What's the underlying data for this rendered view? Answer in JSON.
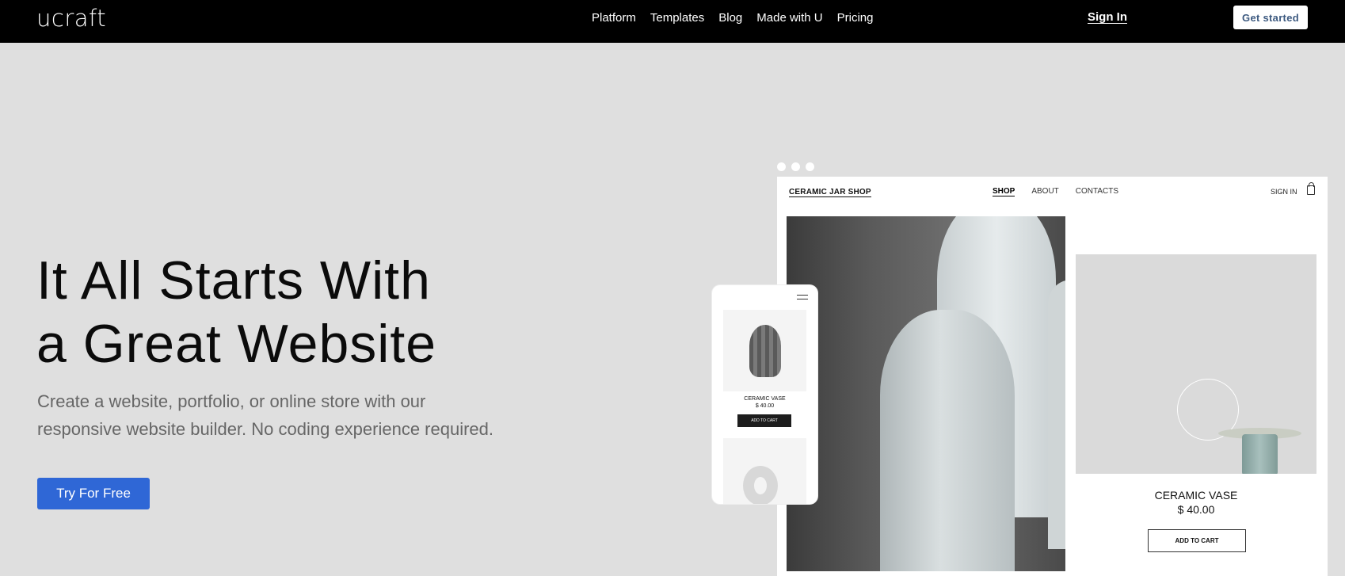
{
  "topbar": {
    "logo": "ucraft",
    "nav": [
      "Platform",
      "Templates",
      "Blog",
      "Made with U",
      "Pricing"
    ],
    "signin": "Sign In",
    "get_started": "Get started"
  },
  "hero": {
    "headline_line1": "It All Starts With",
    "headline_line2": "a Great Website",
    "subtext_line1": "Create a website, portfolio, or online store with our",
    "subtext_line2": "responsive website builder. No coding experience required.",
    "cta": "Try For Free"
  },
  "mockup": {
    "shop_logo": "CERAMIC JAR SHOP",
    "shop_nav": [
      "SHOP",
      "ABOUT",
      "CONTACTS"
    ],
    "shop_signin": "SIGN IN",
    "product_name": "CERAMIC VASE",
    "product_price": "$ 40.00",
    "add_to_cart": "ADD TO CART"
  },
  "phone": {
    "product_name": "CERAMIC VASE",
    "product_price": "$ 40.00",
    "add_to_cart": "ADD TO CART"
  },
  "colors": {
    "topbar_bg": "#000000",
    "page_bg": "#dfdfdf",
    "cta_bg": "#2f67d6"
  }
}
